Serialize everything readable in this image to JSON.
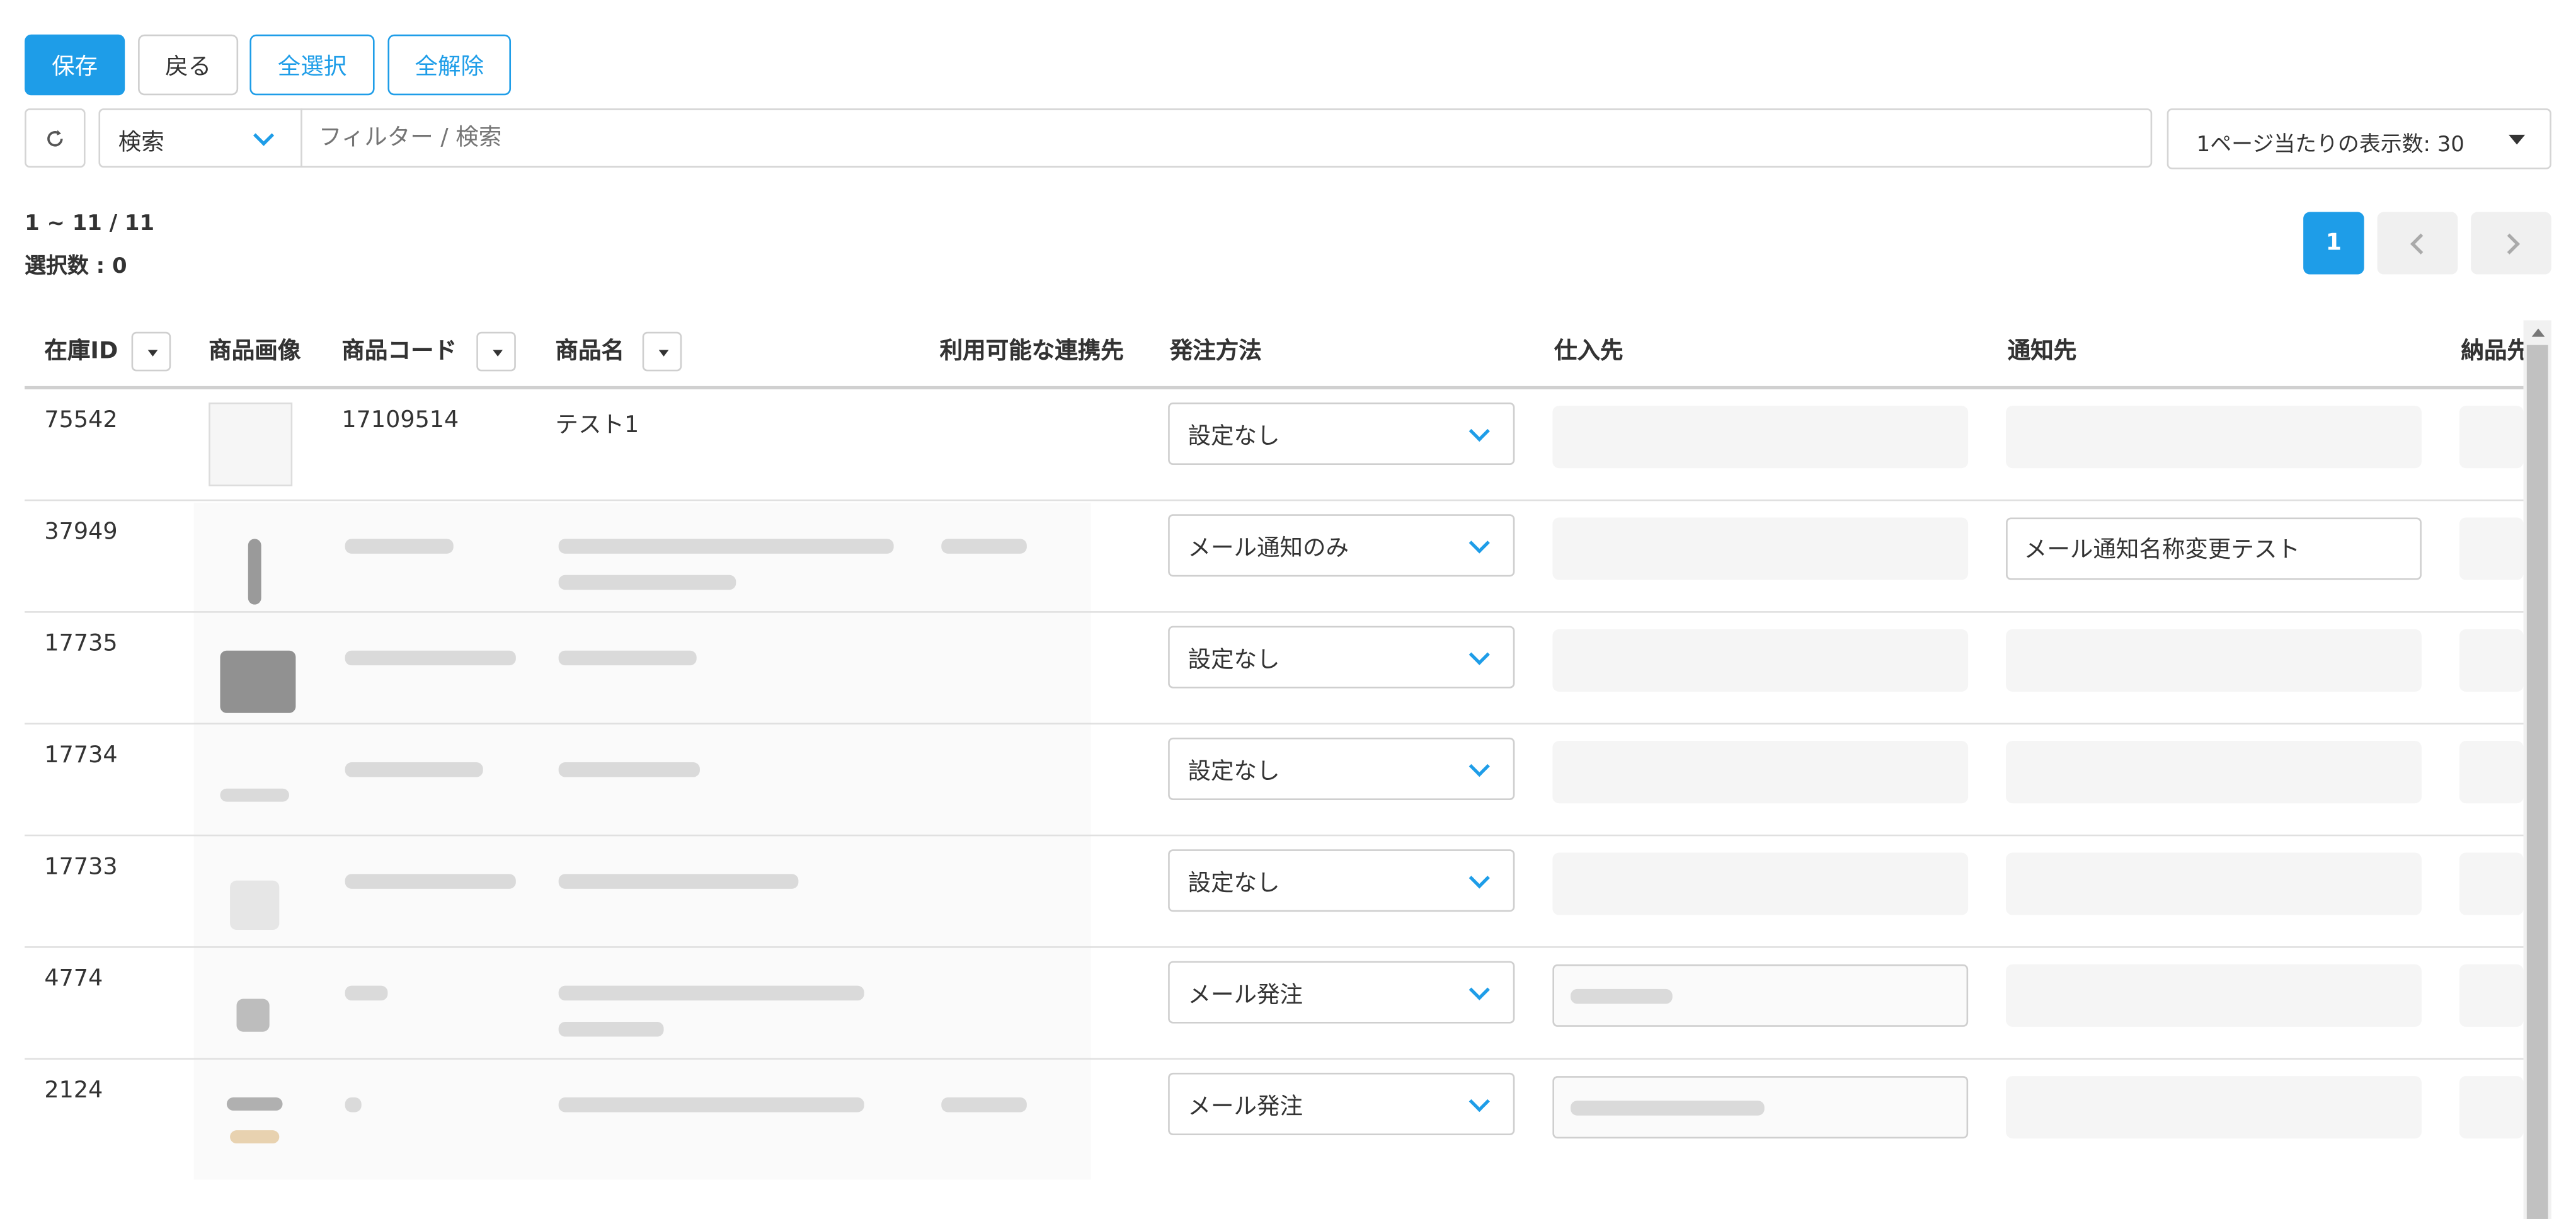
{
  "toolbar": {
    "save_label": "保存",
    "back_label": "戻る",
    "select_all_label": "全選択",
    "deselect_all_label": "全解除"
  },
  "search": {
    "mode_value": "検索",
    "placeholder": "フィルター / 検索",
    "per_page_label": "1ページ当たりの表示数: 30"
  },
  "summary": {
    "range": "1 ~ 11 / 11",
    "selected": "選択数 : 0"
  },
  "pagination": {
    "current_page": "1"
  },
  "table": {
    "headers": {
      "stock_id": "在庫ID",
      "image": "商品画像",
      "code": "商品コード",
      "name": "商品名",
      "integrations": "利用可能な連携先",
      "order_method": "発注方法",
      "supplier": "仕入先",
      "notify": "通知先",
      "delivery": "納品先"
    },
    "rows": [
      {
        "stock_id": "75542",
        "code": "17109514",
        "name": "テスト1",
        "order_method": "設定なし",
        "notify": ""
      },
      {
        "stock_id": "37949",
        "code": "",
        "name": "",
        "order_method": "メール通知のみ",
        "notify": "メール通知名称変更テスト"
      },
      {
        "stock_id": "17735",
        "code": "",
        "name": "",
        "order_method": "設定なし",
        "notify": ""
      },
      {
        "stock_id": "17734",
        "code": "",
        "name": "",
        "order_method": "設定なし",
        "notify": ""
      },
      {
        "stock_id": "17733",
        "code": "",
        "name": "",
        "order_method": "設定なし",
        "notify": ""
      },
      {
        "stock_id": "4774",
        "code": "",
        "name": "",
        "order_method": "メール発注",
        "notify": ""
      },
      {
        "stock_id": "2124",
        "code": "",
        "name": "",
        "order_method": "メール発注",
        "notify": ""
      }
    ]
  },
  "colors": {
    "primary": "#1e9de8",
    "border": "#cfcfcf",
    "disabled_field": "#f5f5f5"
  }
}
